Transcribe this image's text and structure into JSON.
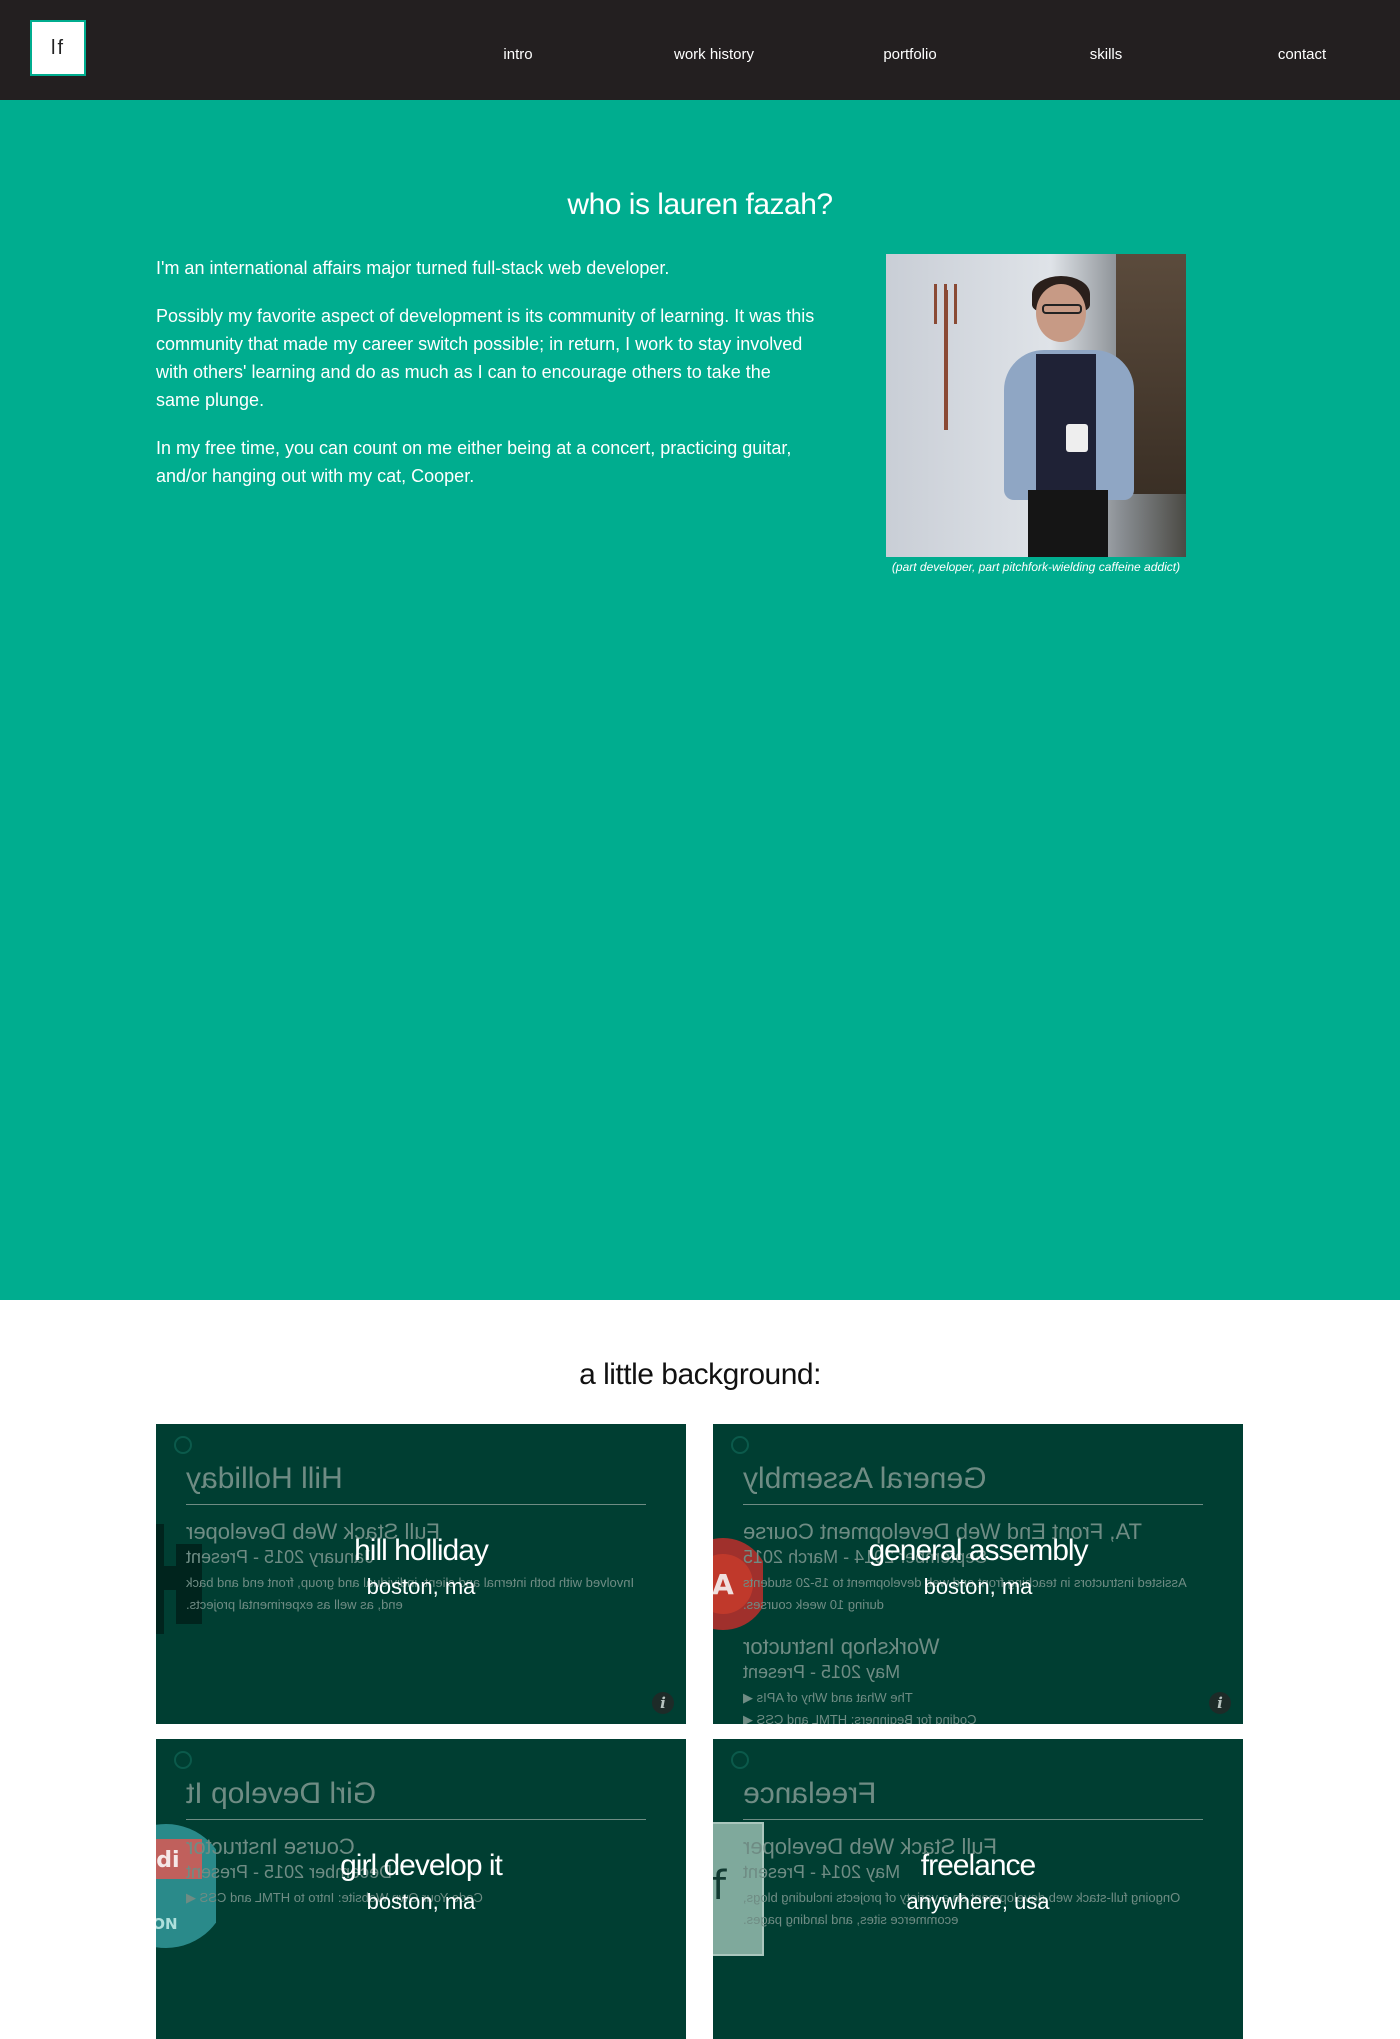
{
  "nav": {
    "logo": "lf",
    "links": [
      "intro",
      "work history",
      "portfolio",
      "skills",
      "contact"
    ]
  },
  "intro": {
    "title": "who is lauren fazah?",
    "paragraphs": [
      "I'm an international affairs major turned full-stack web developer.",
      "Possibly my favorite aspect of development is its community of learning. It was this community that made my career switch possible; in return, I work to stay involved with others' learning and do as much as I can to encourage others to take the same plunge.",
      "In my free time, you can count on me either being at a concert, practicing guitar, and/or hanging out with my cat, Cooper."
    ],
    "photo_caption": "(part developer, part pitchfork-wielding caffeine addict)"
  },
  "background": {
    "title": "a little background:",
    "cards": [
      {
        "name": "hill holliday",
        "location": "boston, ma",
        "logo": "H",
        "back_title": "Hill Holliday",
        "back_role": "Full Stack Web Developer",
        "back_dates": "January 2015 - Present",
        "back_desc": "Involved with both internal and client, individual and group, front end and back end, as well as experimental projects."
      },
      {
        "name": "general assembly",
        "location": "boston, ma",
        "logo": "A",
        "back_title": "General Assembly",
        "back_role": "TA, Front End Web Development Course",
        "back_dates": "September 2014 - March 2015",
        "back_desc": "Assisted instructors in teaching front end web development to 15-20 students during 10 week courses.",
        "back_role2": "Workshop Instructor",
        "back_dates2": "May 2015 - Present",
        "back_items": [
          "The What and Why of APIs ◀",
          "Coding for Beginners: HTML and CSS ◀"
        ]
      },
      {
        "name": "girl develop it",
        "location": "boston, ma",
        "logo": "gdi",
        "back_title": "Girl Develop It",
        "back_role": "Course Instructor",
        "back_dates": "December 2015 - Present",
        "back_desc": "Code Your Own Website: Intro to HTML and CSS ◀"
      },
      {
        "name": "freelance",
        "location": "anywhere, usa",
        "logo": "f",
        "back_title": "Freelance",
        "back_role": "Full Stack Web Developer",
        "back_dates": "May 2014 - Present",
        "back_desc": "Ongoing full-stack web development on a variety of projects including blogs, ecommerce sites, and landing pages."
      }
    ],
    "info_glyph": "i"
  },
  "colors": {
    "nav_bg": "#231f20",
    "accent": "#00ad8f",
    "card_bg": "#003e32"
  }
}
